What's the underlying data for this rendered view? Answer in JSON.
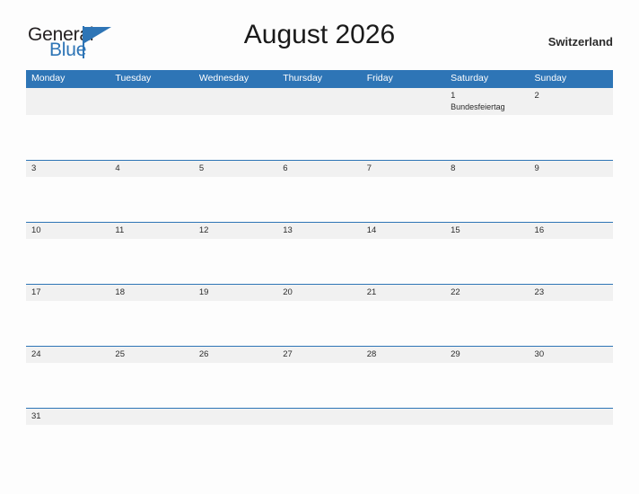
{
  "brand": {
    "name_part1": "General",
    "name_part2": "Blue",
    "triangle_icon": "triangle-icon",
    "color_dark": "#231f20",
    "color_blue": "#2e75b6"
  },
  "header": {
    "title": "August 2026",
    "region": "Switzerland"
  },
  "theme": {
    "header_blue": "#2e75b6",
    "band_gray": "#f1f1f1",
    "page_background": "#fdfdfd",
    "text_dark": "#2b2b2b"
  },
  "calendar": {
    "weekdays": [
      "Monday",
      "Tuesday",
      "Wednesday",
      "Thursday",
      "Friday",
      "Saturday",
      "Sunday"
    ],
    "weeks": [
      {
        "days": [
          {
            "num": "",
            "event": ""
          },
          {
            "num": "",
            "event": ""
          },
          {
            "num": "",
            "event": ""
          },
          {
            "num": "",
            "event": ""
          },
          {
            "num": "",
            "event": ""
          },
          {
            "num": "1",
            "event": "Bundesfeiertag"
          },
          {
            "num": "2",
            "event": ""
          }
        ]
      },
      {
        "days": [
          {
            "num": "3",
            "event": ""
          },
          {
            "num": "4",
            "event": ""
          },
          {
            "num": "5",
            "event": ""
          },
          {
            "num": "6",
            "event": ""
          },
          {
            "num": "7",
            "event": ""
          },
          {
            "num": "8",
            "event": ""
          },
          {
            "num": "9",
            "event": ""
          }
        ]
      },
      {
        "days": [
          {
            "num": "10",
            "event": ""
          },
          {
            "num": "11",
            "event": ""
          },
          {
            "num": "12",
            "event": ""
          },
          {
            "num": "13",
            "event": ""
          },
          {
            "num": "14",
            "event": ""
          },
          {
            "num": "15",
            "event": ""
          },
          {
            "num": "16",
            "event": ""
          }
        ]
      },
      {
        "days": [
          {
            "num": "17",
            "event": ""
          },
          {
            "num": "18",
            "event": ""
          },
          {
            "num": "19",
            "event": ""
          },
          {
            "num": "20",
            "event": ""
          },
          {
            "num": "21",
            "event": ""
          },
          {
            "num": "22",
            "event": ""
          },
          {
            "num": "23",
            "event": ""
          }
        ]
      },
      {
        "days": [
          {
            "num": "24",
            "event": ""
          },
          {
            "num": "25",
            "event": ""
          },
          {
            "num": "26",
            "event": ""
          },
          {
            "num": "27",
            "event": ""
          },
          {
            "num": "28",
            "event": ""
          },
          {
            "num": "29",
            "event": ""
          },
          {
            "num": "30",
            "event": ""
          }
        ]
      },
      {
        "days": [
          {
            "num": "31",
            "event": ""
          },
          {
            "num": "",
            "event": ""
          },
          {
            "num": "",
            "event": ""
          },
          {
            "num": "",
            "event": ""
          },
          {
            "num": "",
            "event": ""
          },
          {
            "num": "",
            "event": ""
          },
          {
            "num": "",
            "event": ""
          }
        ]
      }
    ]
  }
}
